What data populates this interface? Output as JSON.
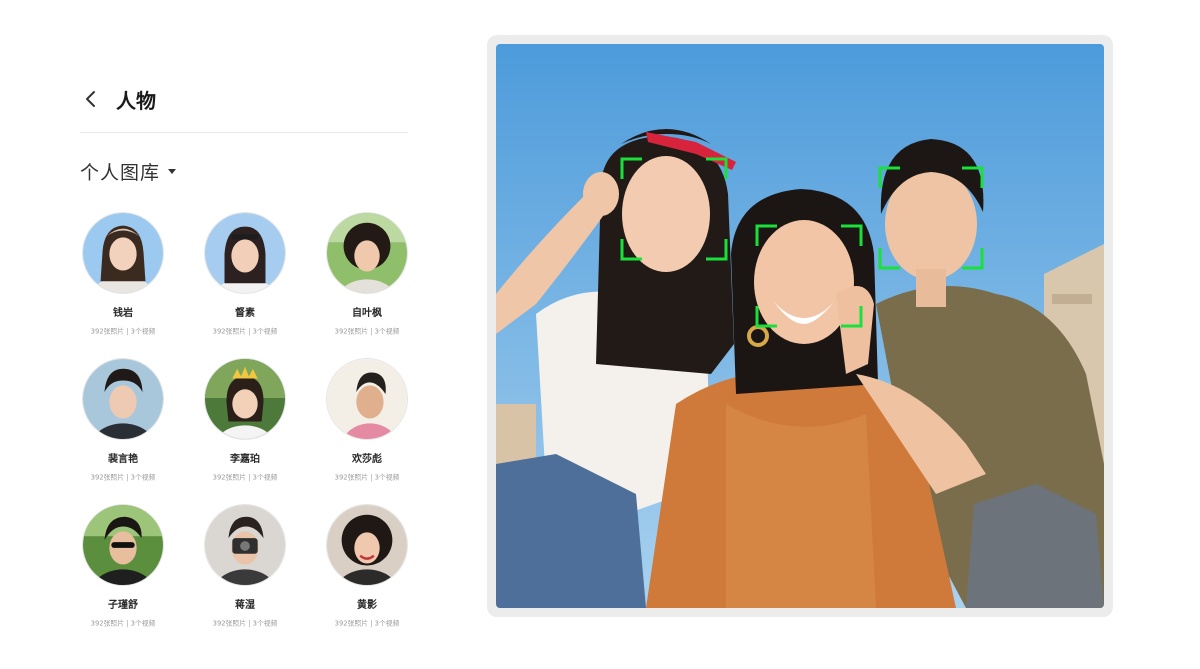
{
  "header": {
    "back_icon": "chevron-left-icon",
    "title": "人物"
  },
  "gallery": {
    "label": "个人图库",
    "caret_icon": "caret-down-icon"
  },
  "people": [
    {
      "name": "钱岩",
      "meta": "392张照片 | 3个视频"
    },
    {
      "name": "督素",
      "meta": "392张照片 | 3个视频"
    },
    {
      "name": "自叶枫",
      "meta": "392张照片 | 3个视频"
    },
    {
      "name": "裴言艳",
      "meta": "392张照片 | 3个视频"
    },
    {
      "name": "李嘉珀",
      "meta": "392张照片 | 3个视频"
    },
    {
      "name": "欢莎彪",
      "meta": "392张照片 | 3个视频"
    },
    {
      "name": "子瑾舒",
      "meta": "392张照片 | 3个视频"
    },
    {
      "name": "蒋湿",
      "meta": "392张照片 | 3个视频"
    },
    {
      "name": "黄影",
      "meta": "392张照片 | 3个视频"
    }
  ],
  "colors": {
    "face_frame": "#19e03a",
    "sky": "#5aa3dc",
    "card_bg": "#ececec"
  }
}
